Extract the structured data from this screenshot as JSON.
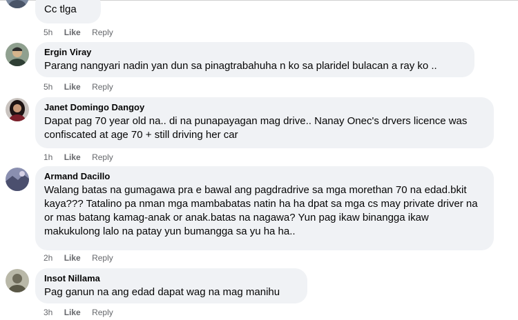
{
  "comments": [
    {
      "author": "",
      "text": "Cc tlga",
      "time": "5h",
      "like": "Like",
      "reply": "Reply",
      "avatar_color": "#6b7a8f"
    },
    {
      "author": "Ergin Viray",
      "text": "Parang nangyari nadin yan dun sa pinagtrabahuha n ko sa plaridel bulacan a ray ko ..",
      "time": "5h",
      "like": "Like",
      "reply": "Reply",
      "avatar_color": "#5a6f5e"
    },
    {
      "author": "Janet Domingo Dangoy",
      "text": "Dapat pag 70 year old na.. di na punapayagan mag drive.. Nanay Onec's drvers licence was confiscated at age 70 + still driving her car",
      "time": "1h",
      "like": "Like",
      "reply": "Reply",
      "avatar_color": "#3b2b2b"
    },
    {
      "author": "Armand Dacillo",
      "text": "Walang batas na gumagawa pra e bawal ang pagdradrive sa mga morethan 70 na edad.bkit kaya??? Tatalino pa nman mga mambabatas natin ha ha dpat sa mga cs may private driver na or mas batang kamag-anak or anak.batas na nagawa? Yun pag ikaw binangga ikaw makukulong lalo na patay yun bumangga sa yu ha ha..",
      "time": "2h",
      "like": "Like",
      "reply": "Reply",
      "avatar_color": "#6a6d8a"
    },
    {
      "author": "Insot Nillama",
      "text": "Pag ganun na ang edad dapat wag na mag manihu",
      "time": "3h",
      "like": "Like",
      "reply": "Reply",
      "avatar_color": "#8a8a7a"
    }
  ]
}
